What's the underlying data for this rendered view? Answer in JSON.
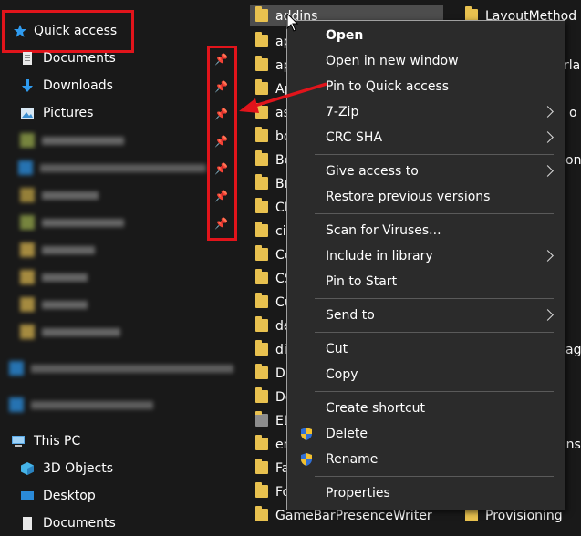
{
  "sidebar": {
    "quick_access": "Quick access",
    "items": [
      {
        "label": "Documents",
        "icon": "documents-icon"
      },
      {
        "label": "Downloads",
        "icon": "downloads-icon"
      },
      {
        "label": "Pictures",
        "icon": "pictures-icon"
      }
    ],
    "this_pc": "This PC",
    "pc_items": [
      {
        "label": "3D Objects",
        "icon": "3d-objects-icon"
      },
      {
        "label": "Desktop",
        "icon": "desktop-icon"
      },
      {
        "label": "Documents",
        "icon": "documents-icon"
      }
    ]
  },
  "files": {
    "col1": [
      "addins",
      "ap",
      "ap",
      "Ap",
      "as",
      "bo",
      "Bo",
      "Br",
      "CB",
      "cit",
      "Co",
      "CS",
      "Cu",
      "de",
      "di",
      "Di",
      "Do",
      "EL",
      "en",
      "Fa",
      "Fo",
      "GameBarPresenceWriter"
    ],
    "col2": [
      {
        "text": "LayoutMethod",
        "row": 0
      },
      {
        "text": "rla",
        "row": 2
      },
      {
        "text": "o",
        "row": 4
      },
      {
        "text": "on",
        "row": 6
      },
      {
        "text": "ag",
        "row": 14
      },
      {
        "text": "ons",
        "row": 18
      },
      {
        "text": "Provisioning",
        "row": 21
      }
    ]
  },
  "context_menu": {
    "items": [
      {
        "label": "Open",
        "bold": true
      },
      {
        "label": "Open in new window"
      },
      {
        "label": "Pin to Quick access"
      },
      {
        "label": "7-Zip",
        "submenu": true
      },
      {
        "label": "CRC SHA",
        "submenu": true
      },
      {
        "label": "Give access to",
        "submenu": true
      },
      {
        "label": "Restore previous versions"
      },
      {
        "label": "Scan for Viruses..."
      },
      {
        "label": "Include in library",
        "submenu": true
      },
      {
        "label": "Pin to Start"
      },
      {
        "label": "Send to",
        "submenu": true
      },
      {
        "label": "Cut"
      },
      {
        "label": "Copy"
      },
      {
        "label": "Create shortcut"
      },
      {
        "label": "Delete",
        "icon": "shield-icon"
      },
      {
        "label": "Rename",
        "icon": "shield-icon"
      },
      {
        "label": "Properties"
      }
    ]
  },
  "colors": {
    "background": "#191919",
    "menu_background": "#2b2b2b",
    "highlight_red": "#e1141b",
    "folder_yellow": "#e8c14f",
    "accent_blue": "#2f9bef"
  }
}
